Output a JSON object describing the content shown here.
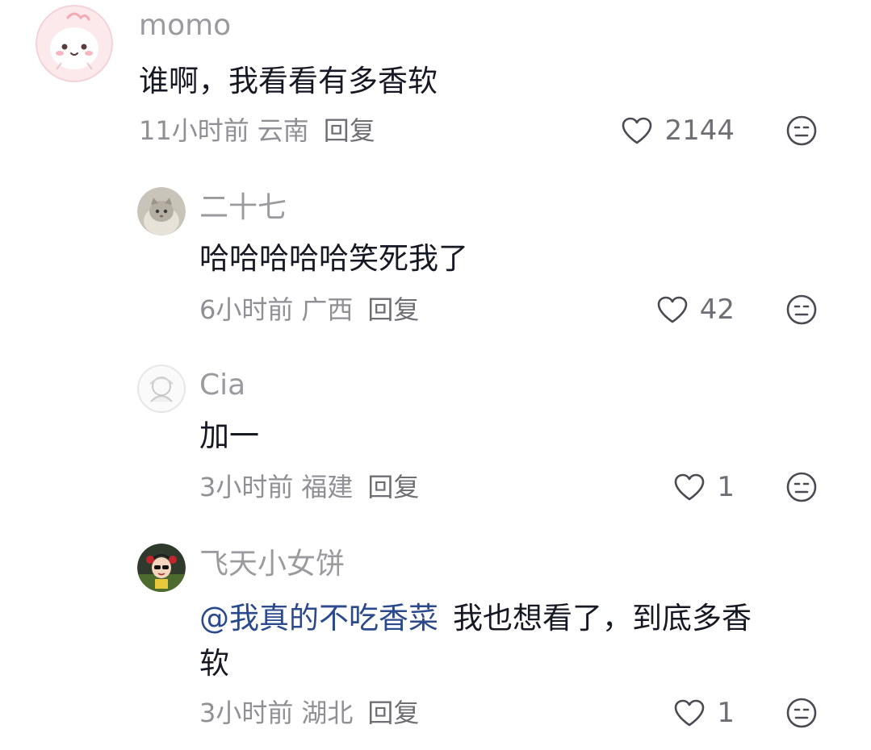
{
  "comments": [
    {
      "username": "momo",
      "text": "谁啊，我看看有多香软",
      "time": "11小时前",
      "location": "云南",
      "reply_label": "回复",
      "likes": "2144"
    },
    {
      "username": "二十七",
      "text": "哈哈哈哈哈笑死我了",
      "time": "6小时前",
      "location": "广西",
      "reply_label": "回复",
      "likes": "42"
    },
    {
      "username": "Cia",
      "text": "加一",
      "time": "3小时前",
      "location": "福建",
      "reply_label": "回复",
      "likes": "1"
    },
    {
      "username": "飞天小女饼",
      "mention": "@我真的不吃香菜",
      "text_line1": "我也想看了，到底多香",
      "text_line2": "软",
      "time": "3小时前",
      "location": "湖北",
      "reply_label": "回复",
      "likes": "1"
    }
  ],
  "colors": {
    "text_primary": "#161823",
    "text_secondary": "#8f8f95",
    "mention": "#2b4a8c",
    "icon": "#4a4a52"
  }
}
